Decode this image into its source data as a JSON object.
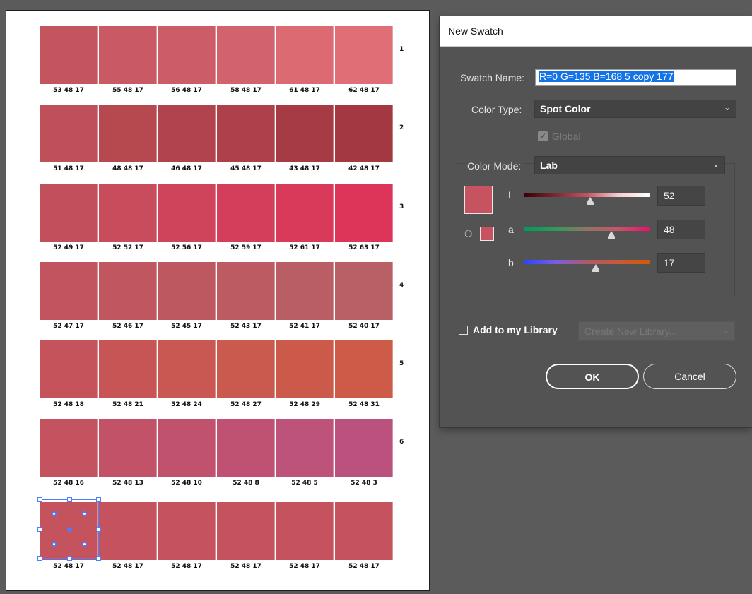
{
  "artboard": {
    "rows": [
      {
        "number": "1",
        "swatches": [
          {
            "label": "53 48 17",
            "color": "#c4555e"
          },
          {
            "label": "55 48 17",
            "color": "#c95a63"
          },
          {
            "label": "56 48 17",
            "color": "#cc5d66"
          },
          {
            "label": "58 48 17",
            "color": "#d2626b"
          },
          {
            "label": "61 48 17",
            "color": "#dc6a73"
          },
          {
            "label": "62 48 17",
            "color": "#e06e77"
          }
        ]
      },
      {
        "number": "2",
        "swatches": [
          {
            "label": "51 48 17",
            "color": "#bf5059"
          },
          {
            "label": "48 48 17",
            "color": "#b64850"
          },
          {
            "label": "46 48 17",
            "color": "#b0434b"
          },
          {
            "label": "45 48 17",
            "color": "#ad4048"
          },
          {
            "label": "43 48 17",
            "color": "#a73b43"
          },
          {
            "label": "42 48 17",
            "color": "#a43840"
          }
        ]
      },
      {
        "number": "3",
        "swatches": [
          {
            "label": "52 49 17",
            "color": "#c2505c"
          },
          {
            "label": "52 52 17",
            "color": "#c94c5c"
          },
          {
            "label": "52 56 17",
            "color": "#d0445b"
          },
          {
            "label": "52 59 17",
            "color": "#d53e5a"
          },
          {
            "label": "52 61 17",
            "color": "#d93a5a"
          },
          {
            "label": "52 63 17",
            "color": "#dc3559"
          }
        ]
      },
      {
        "number": "4",
        "swatches": [
          {
            "label": "52 47 17",
            "color": "#c1545e"
          },
          {
            "label": "52 46 17",
            "color": "#c0565f"
          },
          {
            "label": "52 45 17",
            "color": "#be5860"
          },
          {
            "label": "52 43 17",
            "color": "#bc5b62"
          },
          {
            "label": "52 41 17",
            "color": "#b95e64"
          },
          {
            "label": "52 40 17",
            "color": "#b86065"
          }
        ]
      },
      {
        "number": "5",
        "swatches": [
          {
            "label": "52 48 18",
            "color": "#c5535c"
          },
          {
            "label": "52 48 21",
            "color": "#c75556"
          },
          {
            "label": "52 48 24",
            "color": "#c95752"
          },
          {
            "label": "52 48 27",
            "color": "#ca594e"
          },
          {
            "label": "52 48 29",
            "color": "#cc5a4b"
          },
          {
            "label": "52 48 31",
            "color": "#cd5b47"
          }
        ]
      },
      {
        "number": "6",
        "swatches": [
          {
            "label": "52 48 16",
            "color": "#c4525f"
          },
          {
            "label": "52 48 13",
            "color": "#c25267"
          },
          {
            "label": "52 48 10",
            "color": "#c0526e"
          },
          {
            "label": "52 48 8",
            "color": "#bf5273"
          },
          {
            "label": "52 48 5",
            "color": "#bd527a"
          },
          {
            "label": "52 48 3",
            "color": "#bb527e"
          }
        ]
      },
      {
        "number": "",
        "swatches": [
          {
            "label": "52 48 17",
            "color": "#c4535e"
          },
          {
            "label": "52 48 17",
            "color": "#c4535e"
          },
          {
            "label": "52 48 17",
            "color": "#c4535e"
          },
          {
            "label": "52 48 17",
            "color": "#c4535e"
          },
          {
            "label": "52 48 17",
            "color": "#c4535e"
          },
          {
            "label": "52 48 17",
            "color": "#c4535e"
          }
        ]
      }
    ]
  },
  "dialog": {
    "title": "New Swatch",
    "swatch_name_label": "Swatch Name:",
    "swatch_name_value": "R=0 G=135 B=168 5 copy 177",
    "color_type_label": "Color Type:",
    "color_type_value": "Spot Color",
    "global_label": "Global",
    "color_mode_label": "Color Mode:",
    "color_mode_value": "Lab",
    "preview_color": "#c6535f",
    "channels": [
      {
        "label": "L",
        "value": "52",
        "position": 0.52
      },
      {
        "label": "a",
        "value": "48",
        "position": 0.69
      },
      {
        "label": "b",
        "value": "17",
        "position": 0.57
      }
    ],
    "add_to_library_label": "Add to my Library",
    "library_placeholder": "Create New Library...",
    "ok_label": "OK",
    "cancel_label": "Cancel"
  }
}
